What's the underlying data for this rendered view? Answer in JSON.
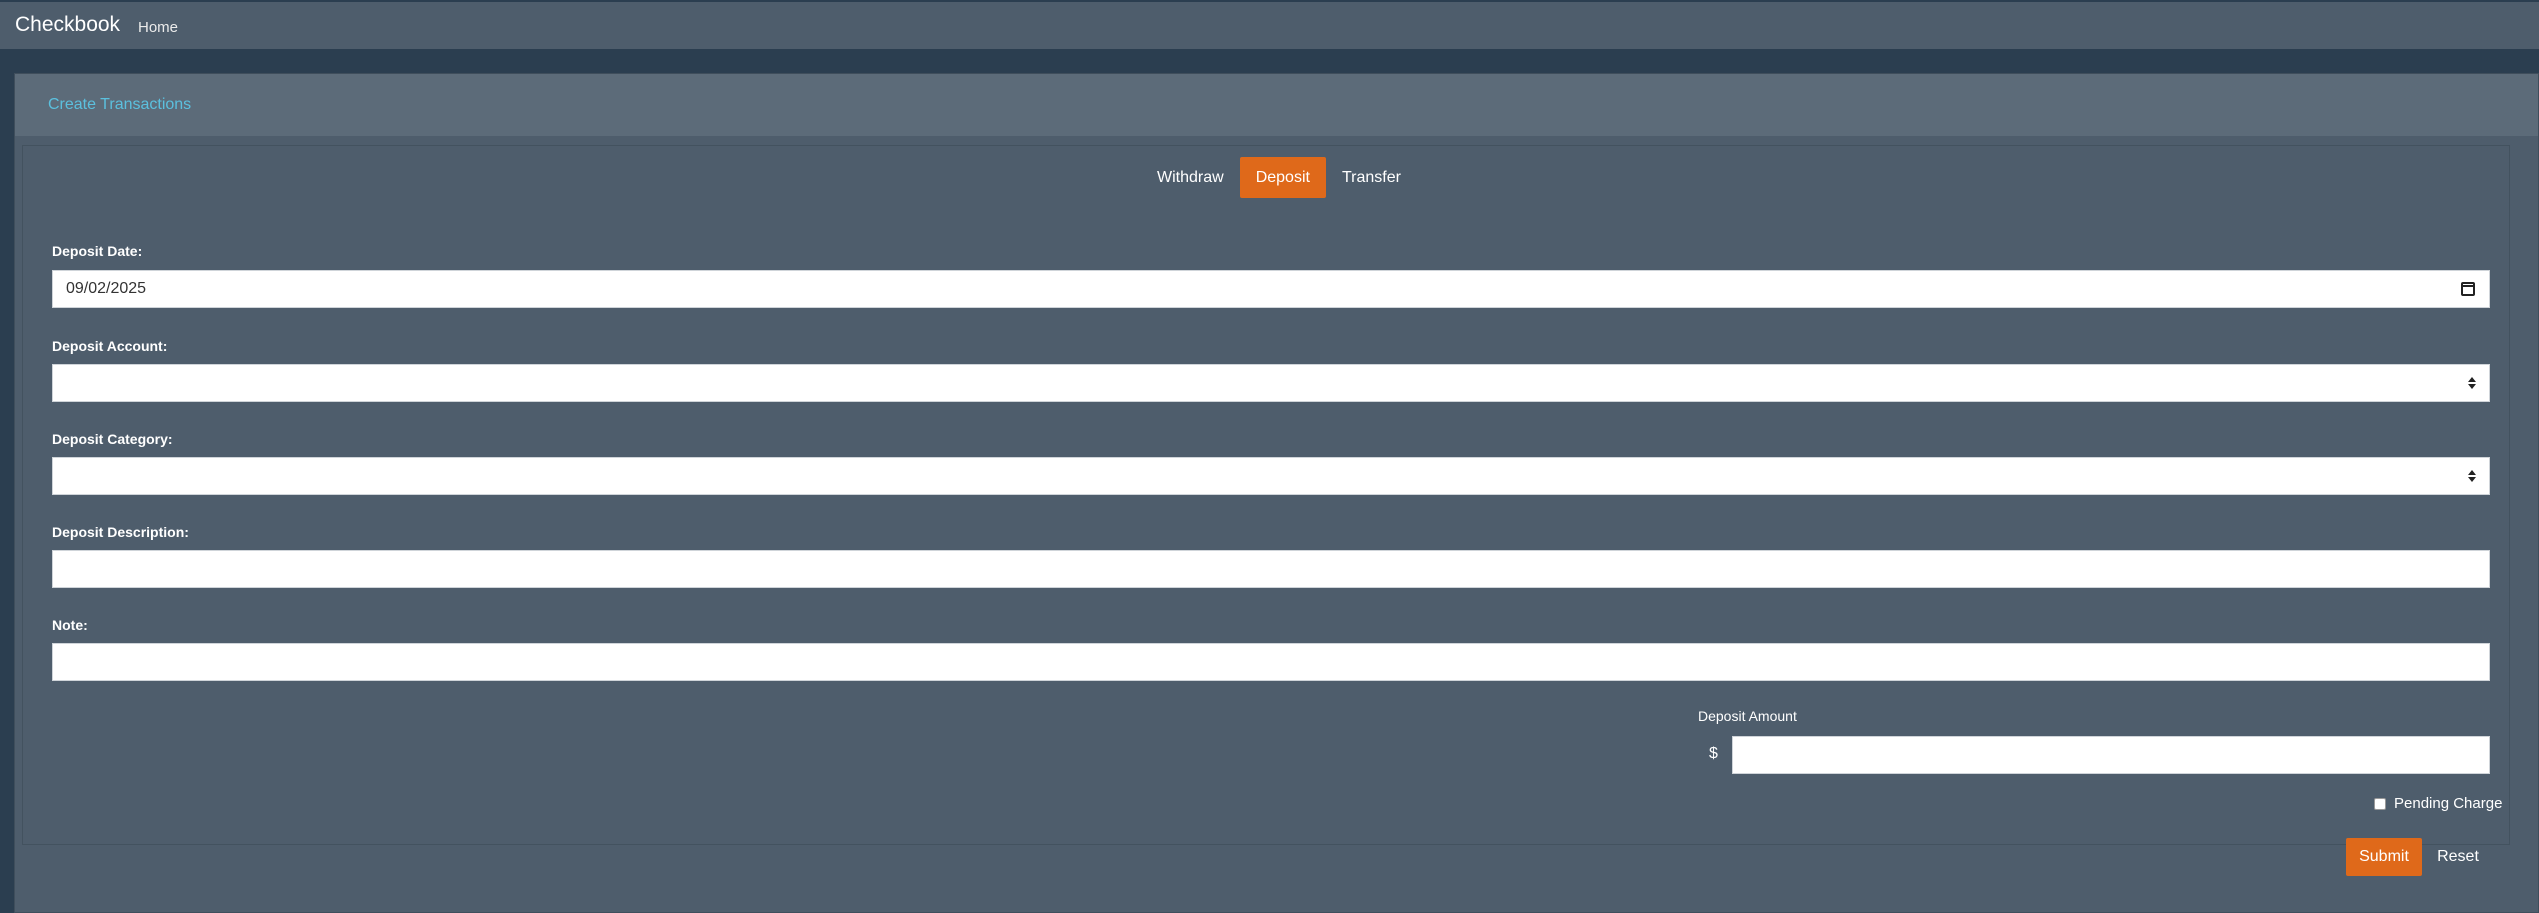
{
  "navbar": {
    "brand": "Checkbook",
    "links": [
      "Home"
    ]
  },
  "card": {
    "title": "Create Transactions"
  },
  "tabs": {
    "items": [
      {
        "label": "Withdraw",
        "active": false
      },
      {
        "label": "Deposit",
        "active": true
      },
      {
        "label": "Transfer",
        "active": false
      }
    ]
  },
  "form": {
    "date_label": "Deposit Date:",
    "date_value": "09/02/2025",
    "account_label": "Deposit Account:",
    "account_value": "",
    "category_label": "Deposit Category:",
    "category_value": "",
    "description_label": "Deposit Description:",
    "description_value": "",
    "note_label": "Note:",
    "note_value": "",
    "amount_label": "Deposit Amount",
    "currency_symbol": "$",
    "amount_value": "",
    "pending_label": "Pending Charge",
    "pending_checked": false,
    "submit_label": "Submit",
    "reset_label": "Reset"
  },
  "colors": {
    "background": "#2b3e50",
    "panel": "#4e5d6c",
    "header": "#5c6b79",
    "accent": "#df691a",
    "link": "#5bc0de"
  },
  "icons": {
    "date_picker": "calendar-icon",
    "select": "select-arrows-icon"
  }
}
